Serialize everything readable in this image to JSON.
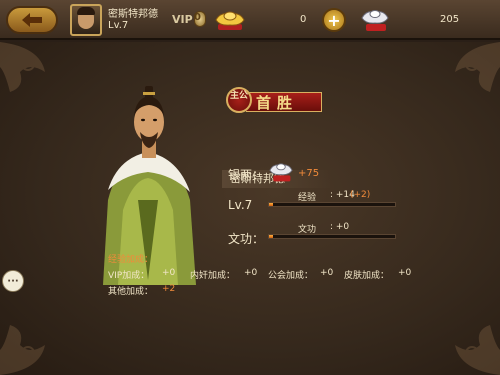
{
  "topbar": {
    "player_name": "密斯特邦德",
    "player_level": "Lv.7",
    "vip_label": "VIP",
    "vip_level": "0",
    "gold_count": "0",
    "silver_count": "205"
  },
  "result": {
    "title": "首胜",
    "seal_text": "主公",
    "hero_name": "密斯特邦德",
    "silver_label": "银两：",
    "silver_gain": "+75",
    "level_label": "Lv.7",
    "exp_label": "经验",
    "exp_gain": ": +14",
    "exp_bonus": "(+2)",
    "exp_progress": 0.03,
    "merit_label_big": "文功：",
    "merit_label": "文功",
    "merit_gain": ": +0",
    "merit_progress": 0.03
  },
  "bonus": {
    "title": "经验加成：",
    "items": [
      {
        "label": "VIP加成：",
        "value": "+0"
      },
      {
        "label": "内奸加成：",
        "value": "+0"
      },
      {
        "label": "公会加成：",
        "value": "+0"
      },
      {
        "label": "皮肤加成：",
        "value": "+0"
      },
      {
        "label": "其他加成：",
        "value": "+2"
      }
    ]
  },
  "chat": {
    "label": "···"
  },
  "colors": {
    "accent": "#f08a3a",
    "gold": "#f5dc8a",
    "seal_red": "#a8201a"
  }
}
